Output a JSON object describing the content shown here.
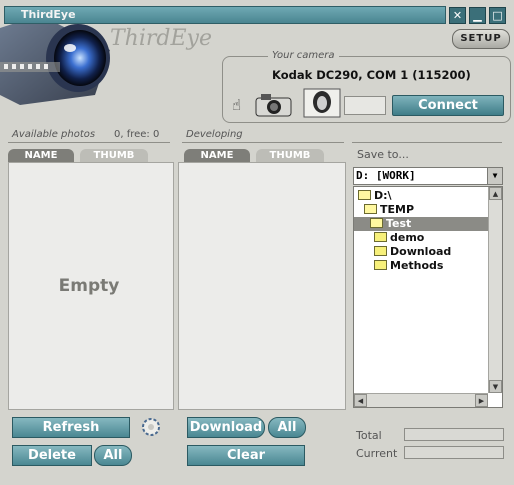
{
  "window": {
    "title": "ThirdEye",
    "logo_text": "ThirdEye",
    "setup_label": "SETUP"
  },
  "camera": {
    "section_label": "Your camera",
    "model": "Kodak DC290, COM 1 (115200)",
    "connect_label": "Connect"
  },
  "available": {
    "label": "Available photos",
    "counts": "0, free: 0",
    "tabs": [
      "NAME",
      "THUMB"
    ],
    "empty_text": "Empty"
  },
  "developing": {
    "label": "Developing",
    "tabs": [
      "NAME",
      "THUMB"
    ]
  },
  "save_to": {
    "label": "Save to...",
    "drive_value": "D:  [WORK]",
    "tree": [
      "D:\\",
      "TEMP",
      "Test",
      "demo",
      "Download",
      "Methods"
    ]
  },
  "buttons": {
    "refresh": "Refresh",
    "delete": "Delete",
    "delete_all": "All",
    "download": "Download",
    "download_all": "All",
    "clear": "Clear"
  },
  "progress": {
    "total_label": "Total",
    "current_label": "Current",
    "total_value": 0,
    "current_value": 0
  },
  "colors": {
    "accent": "#4a8792",
    "panel": "#d4d4ce",
    "list_bg": "#ececea"
  }
}
